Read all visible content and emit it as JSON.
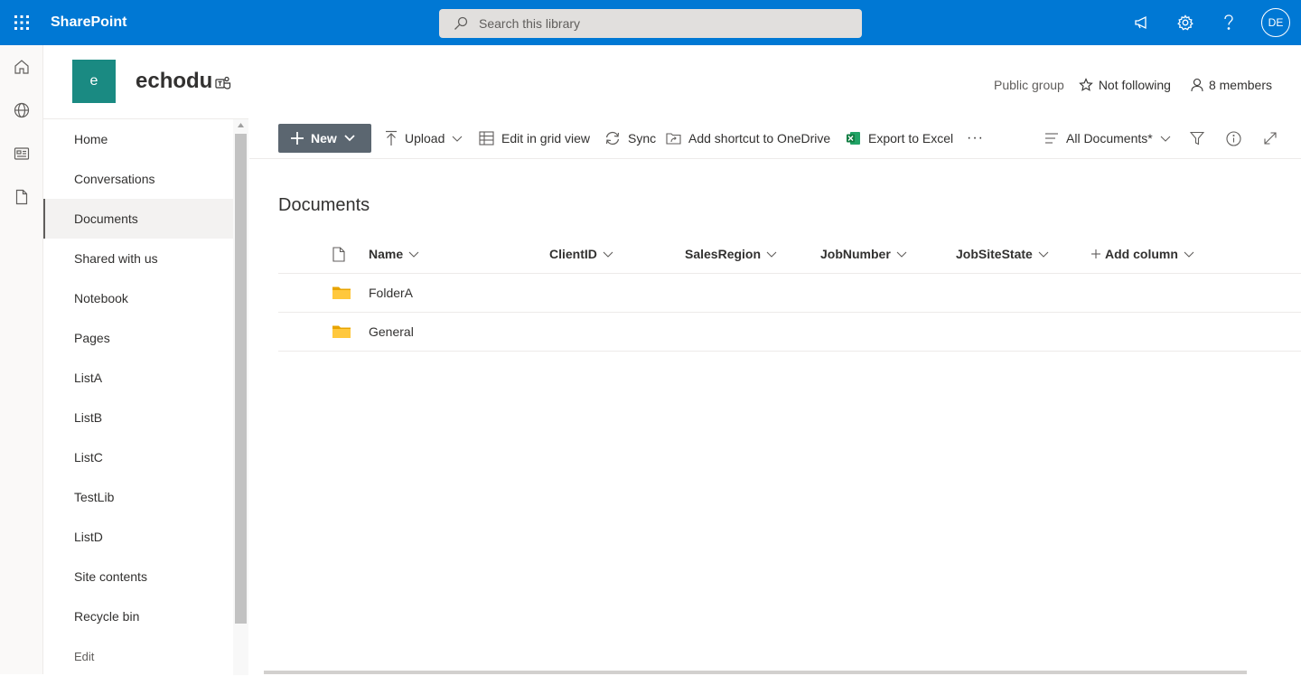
{
  "suite": {
    "brand": "SharePoint",
    "search_placeholder": "Search this library",
    "avatar_initials": "DE"
  },
  "site": {
    "logo_letter": "e",
    "title": "echodu",
    "group_type": "Public group",
    "follow_label": "Not following",
    "members_label": "8 members"
  },
  "nav": {
    "items": [
      {
        "label": "Home"
      },
      {
        "label": "Conversations"
      },
      {
        "label": "Documents",
        "selected": true
      },
      {
        "label": "Shared with us"
      },
      {
        "label": "Notebook"
      },
      {
        "label": "Pages"
      },
      {
        "label": "ListA"
      },
      {
        "label": "ListB"
      },
      {
        "label": "ListC"
      },
      {
        "label": "TestLib"
      },
      {
        "label": "ListD"
      },
      {
        "label": "Site contents"
      },
      {
        "label": "Recycle bin"
      }
    ],
    "edit_label": "Edit"
  },
  "commandbar": {
    "new_label": "New",
    "upload_label": "Upload",
    "grid_label": "Edit in grid view",
    "sync_label": "Sync",
    "shortcut_label": "Add shortcut to OneDrive",
    "export_label": "Export to Excel",
    "more_label": "···",
    "view_label": "All Documents*"
  },
  "library": {
    "title": "Documents",
    "columns": [
      "Name",
      "ClientID",
      "SalesRegion",
      "JobNumber",
      "JobSiteState",
      "Add column"
    ],
    "rows": [
      {
        "name": "FolderA",
        "type": "folder"
      },
      {
        "name": "General",
        "type": "folder"
      }
    ]
  },
  "colors": {
    "suite_bar": "#0078d4",
    "site_logo": "#1a8a82",
    "new_button": "#5b6670",
    "folder": "#ffb900",
    "excel": "#107c41"
  }
}
